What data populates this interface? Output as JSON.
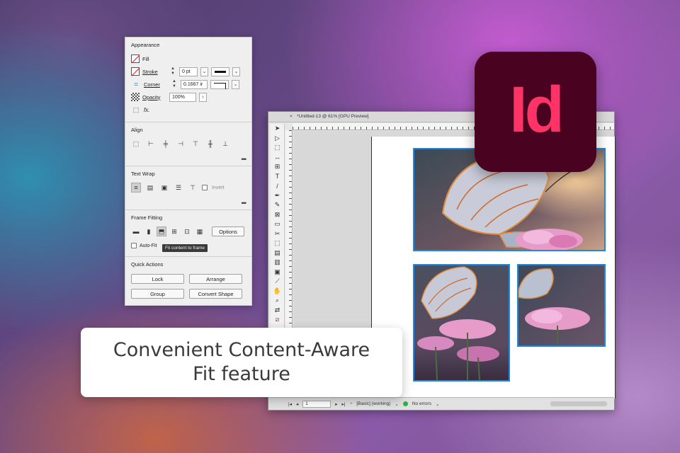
{
  "panel": {
    "appearance": {
      "title": "Appearance",
      "fill_label": "Fill",
      "stroke_label": "Stroke",
      "stroke_weight": "0 pt",
      "corner_label": "Corner",
      "corner_value": "0.1667 ir",
      "opacity_label": "Opacity",
      "opacity_value": "100%",
      "fx_label": "fx."
    },
    "align": {
      "title": "Align"
    },
    "text_wrap": {
      "title": "Text Wrap",
      "invert_label": "Invert"
    },
    "frame_fitting": {
      "title": "Frame Fitting",
      "options_label": "Options",
      "auto_fit_label": "Auto-Fit",
      "tooltip": "Fit content to frame"
    },
    "quick_actions": {
      "title": "Quick Actions",
      "lock_label": "Lock",
      "arrange_label": "Arrange",
      "group_label": "Group",
      "convert_shape_label": "Convert Shape"
    }
  },
  "document": {
    "tab_title": "*Untitled-13 @ 61% [GPU Preview]",
    "page_number": "1",
    "style": "[Basic] (working)",
    "errors": "No errors"
  },
  "logo": {
    "text": "Id",
    "color": "#ff3366",
    "background": "#49021f"
  },
  "caption": {
    "line1": "Convenient Content-Aware",
    "line2": "Fit feature"
  }
}
